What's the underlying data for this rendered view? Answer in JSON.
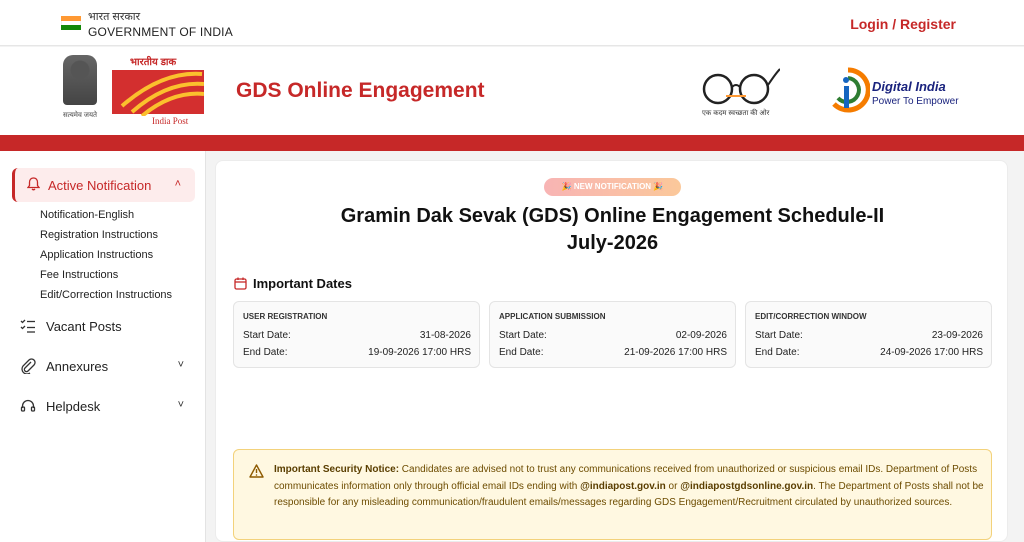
{
  "topbar": {
    "gov_hindi": "भारत सरकार",
    "gov_english": "GOVERNMENT OF INDIA",
    "login_label": "Login / Register"
  },
  "header": {
    "emblem_caption": "सत्यमेव जयते",
    "post_logo_hindi": "भारतीय डाक",
    "post_logo_english": "India Post",
    "site_title": "GDS Online Engagement",
    "swachh_caption": "एक कदम स्वच्छता की ओर",
    "digital_india_title": "Digital India",
    "digital_india_tagline": "Power To Empower"
  },
  "sidebar": {
    "active": {
      "label": "Active Notification",
      "icon": "bell-icon",
      "expanded": true
    },
    "sub_items": [
      "Notification-English",
      "Registration Instructions",
      "Application Instructions",
      "Fee Instructions",
      "Edit/Correction Instructions"
    ],
    "items": [
      {
        "label": "Vacant Posts",
        "icon": "list-icon"
      },
      {
        "label": "Annexures",
        "icon": "paperclip-icon"
      },
      {
        "label": "Helpdesk",
        "icon": "headset-icon"
      }
    ]
  },
  "main": {
    "badge": "🎉 NEW NOTIFICATION 🎉",
    "title_line1": "Gramin Dak Sevak (GDS) Online Engagement Schedule-II",
    "title_line2": "July-2026",
    "dates_heading": "Important Dates",
    "date_boxes": [
      {
        "heading": "USER REGISTRATION",
        "start_label": "Start Date:",
        "start": "31-08-2026",
        "end_label": "End Date:",
        "end": "19-09-2026 17:00 HRS"
      },
      {
        "heading": "APPLICATION SUBMISSION",
        "start_label": "Start Date:",
        "start": "02-09-2026",
        "end_label": "End Date:",
        "end": "21-09-2026 17:00 HRS"
      },
      {
        "heading": "EDIT/CORRECTION WINDOW",
        "start_label": "Start Date:",
        "start": "23-09-2026",
        "end_label": "End Date:",
        "end": "24-09-2026 17:00 HRS"
      }
    ],
    "notice": {
      "heading": "Important Security Notice:",
      "text1": " Candidates are advised not to trust any communications received from unauthorized or suspicious email IDs. Department of Posts communicates information only through official email IDs ending with ",
      "domain1": "@indiapost.gov.in",
      "text2": " or ",
      "domain2": "@indiapostgdsonline.gov.in",
      "text3": ". The Department of Posts shall not be responsible for any misleading communication/fraudulent emails/messages regarding GDS Engagement/Recruitment circulated by unauthorized sources."
    }
  },
  "colors": {
    "brand_red": "#c62828",
    "notice_bg": "#fff8e1"
  }
}
